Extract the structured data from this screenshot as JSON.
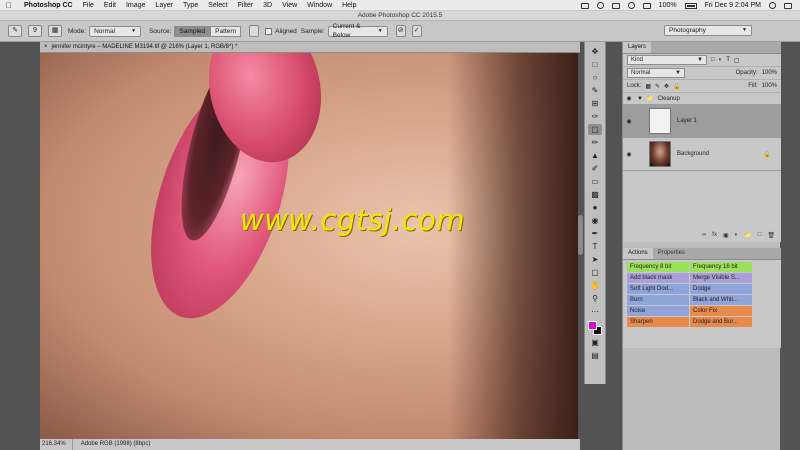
{
  "menubar": {
    "app_name": "Photoshop CC",
    "menus": [
      "File",
      "Edit",
      "Image",
      "Layer",
      "Type",
      "Select",
      "Filter",
      "3D",
      "View",
      "Window",
      "Help"
    ],
    "battery": "100%",
    "datetime": "Fri Dec 9  2:04 PM"
  },
  "window_title": "Adobe Photoshop CC 2015.5",
  "options": {
    "brush_size": "9",
    "mode_label": "Mode:",
    "mode_value": "Normal",
    "source_label": "Source:",
    "source_sampled": "Sampled",
    "source_pattern": "Pattern",
    "aligned_label": "Aligned",
    "sample_label": "Sample:",
    "sample_value": "Current & Below",
    "workspace": "Photography"
  },
  "document": {
    "tab_title": "jennifer mcintyre – MADELINE M3194.tif @ 216% (Layer 1, RGB/8*) *",
    "watermark": "www.cgtsj.com",
    "zoom": "216.34%",
    "profile": "Adobe RGB (1998) (8bpc)"
  },
  "tools": [
    "move-tool",
    "marquee-tool",
    "lasso-tool",
    "quick-select-tool",
    "crop-tool",
    "eyedropper-tool",
    "healing-brush-tool",
    "brush-tool",
    "clone-stamp-tool",
    "history-brush-tool",
    "eraser-tool",
    "gradient-tool",
    "blur-tool",
    "dodge-tool",
    "pen-tool",
    "type-tool",
    "path-select-tool",
    "rectangle-tool",
    "hand-tool",
    "zoom-tool",
    "more-tools"
  ],
  "swatches": {
    "foreground": "#d80ac8",
    "background": "#111111"
  },
  "layers_panel": {
    "tab": "Layers",
    "kind_filter": "Kind",
    "blend_mode": "Normal",
    "opacity_label": "Opacity:",
    "opacity_value": "100%",
    "lock_label": "Lock:",
    "fill_label": "Fill:",
    "fill_value": "100%",
    "layers": [
      {
        "name": "Cleanup",
        "type": "group"
      },
      {
        "name": "Layer 1",
        "type": "layer",
        "selected": true
      },
      {
        "name": "Background",
        "type": "background",
        "locked": true
      }
    ]
  },
  "actions_panel": {
    "tabs": [
      "Actions",
      "Properties"
    ],
    "buttons": [
      {
        "label": "Frequency 8 bit",
        "color": "#9be05a"
      },
      {
        "label": "Frequency 16 bit",
        "color": "#9be05a"
      },
      {
        "label": "Add black mask",
        "color": "#a99ed6"
      },
      {
        "label": "Merge Visible S...",
        "color": "#a99ed6"
      },
      {
        "label": "Soft Light Dod...",
        "color": "#8fa4d8"
      },
      {
        "label": "Dodge",
        "color": "#8fa4d8"
      },
      {
        "label": "Burn",
        "color": "#8fa4d8"
      },
      {
        "label": "Black and Whit...",
        "color": "#8fa4d8"
      },
      {
        "label": "Noise",
        "color": "#8fa4d8"
      },
      {
        "label": "Color Fix",
        "color": "#e88a4c"
      },
      {
        "label": "Sharpen",
        "color": "#e88a4c"
      },
      {
        "label": "Dodge and Bur...",
        "color": "#e88a4c"
      }
    ]
  }
}
